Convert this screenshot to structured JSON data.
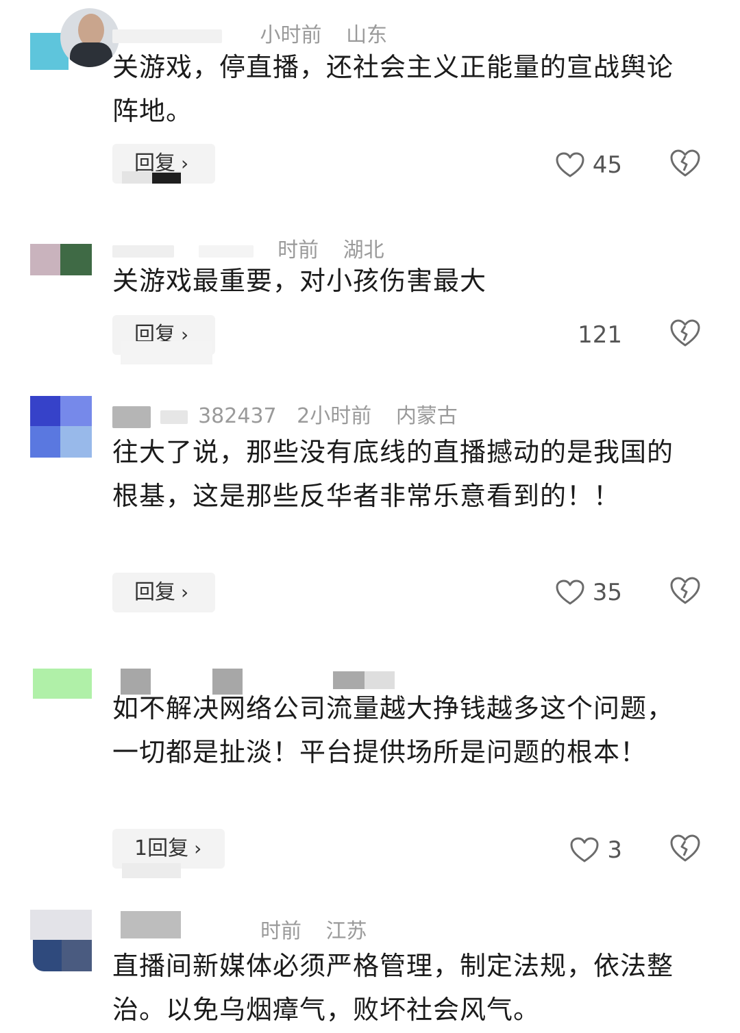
{
  "comments": [
    {
      "time": "小时前",
      "region": "山东",
      "text": "关游戏，停直播，还社会主义正能量的宣战舆论阵地。",
      "reply_label": "回复",
      "likes": "45"
    },
    {
      "time": "时前",
      "region": "湖北",
      "text": "关游戏最重要，对小孩伤害最大",
      "reply_label": "回复",
      "likes": "121"
    },
    {
      "user_suffix": "382437",
      "time": "2小时前",
      "region": "内蒙古",
      "text": "往大了说，那些没有底线的直播撼动的是我国的根基，这是那些反华者非常乐意看到的！！",
      "reply_label": "回复",
      "likes": "35"
    },
    {
      "text": "如不解决网络公司流量越大挣钱越多这个问题，一切都是扯淡！平台提供场所是问题的根本！",
      "reply_label": "1回复",
      "likes": "3"
    },
    {
      "time": "时前",
      "region": "江苏",
      "text": "直播间新媒体必须严格管理，制定法规，依法整治。以免乌烟瘴气，败坏社会风气。"
    }
  ],
  "icons": {
    "like": "heart-outline-icon",
    "dislike": "broken-heart-icon",
    "chevron": "chevron-right-icon"
  },
  "colors": {
    "text": "#1b1b1b",
    "meta": "#9a9a9a",
    "reply_bg": "#f3f3f3"
  }
}
